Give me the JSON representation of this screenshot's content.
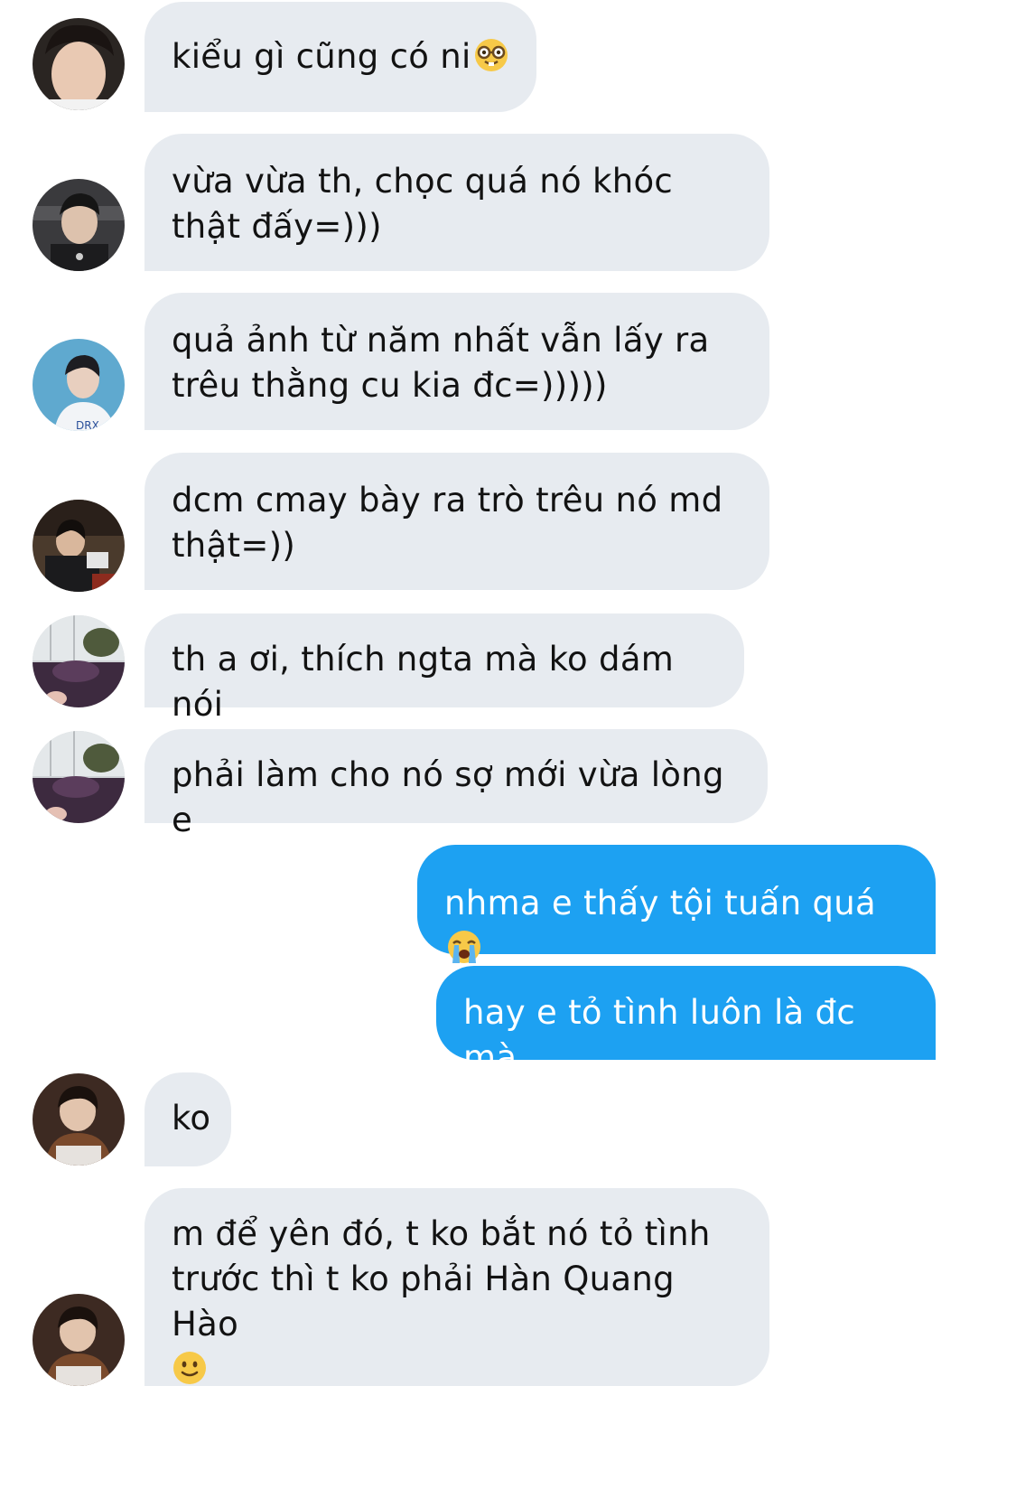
{
  "conversation": {
    "messages": [
      {
        "text": "kiểu gì cũng có ni",
        "emoji": "nerd-face"
      },
      {
        "text": "vừa vừa th, chọc quá nó khóc thật đấy=)))"
      },
      {
        "text": "quả ảnh từ năm nhất vẫn lấy ra trêu thằng cu kia đc=)))))"
      },
      {
        "text": "dcm cmay bày ra trò trêu nó md thật=))"
      },
      {
        "text": "th a ơi, thích ngta mà ko dám nói"
      },
      {
        "text": "phải làm cho nó sợ mới vừa lòng e"
      },
      {
        "text": "nhma e thấy tội tuấn quá",
        "emoji": "loudly-crying-face"
      },
      {
        "text": "hay e tỏ tình luôn là đc mà"
      },
      {
        "text": "ko"
      },
      {
        "text": "m để yên đó, t ko bắt nó tỏ tình trước thì t ko phải Hàn Quang Hào",
        "emoji": "slightly-smiling-face"
      }
    ]
  },
  "colors": {
    "incoming_bubble": "#e7ebf0",
    "outgoing_bubble": "#1da1f2",
    "outgoing_text": "#ffffff"
  }
}
